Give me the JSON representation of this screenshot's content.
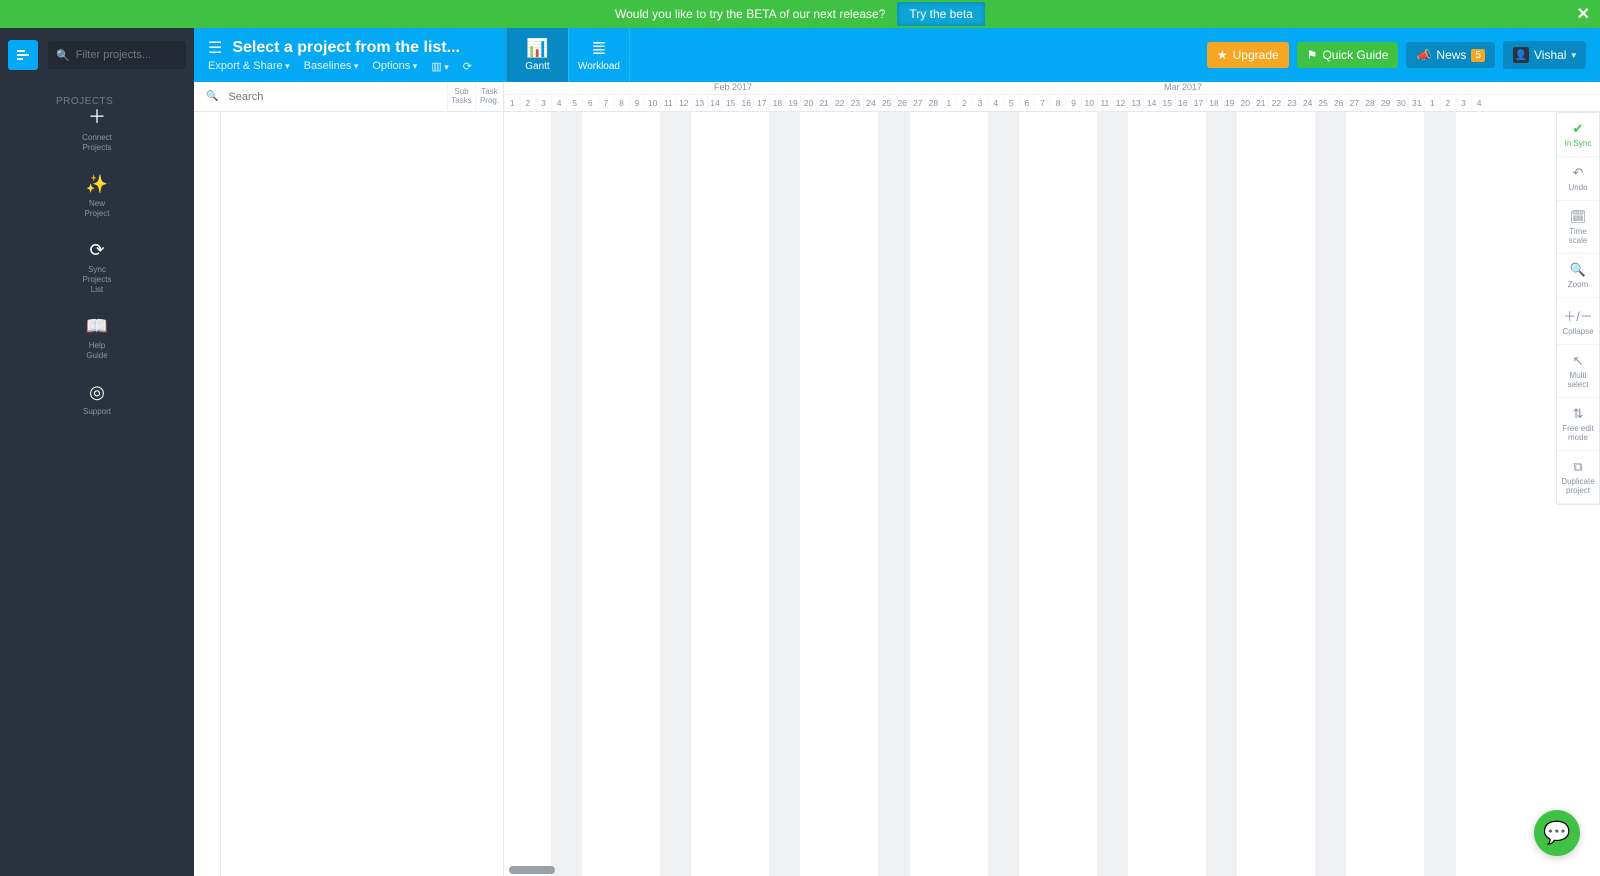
{
  "banner": {
    "text": "Would you like to try the BETA of our next release?",
    "button": "Try the beta"
  },
  "sidebar": {
    "filter_placeholder": "Filter projects...",
    "projects_label": "PROJECTS",
    "items": [
      {
        "label": "Connect\nProjects"
      },
      {
        "label": "New\nProject"
      },
      {
        "label": "Sync Projects\nList"
      },
      {
        "label": "Help\nGuide"
      },
      {
        "label": "Support"
      }
    ]
  },
  "topbar": {
    "title": "Select a project from the list...",
    "menu": {
      "export": "Export & Share",
      "baselines": "Baselines",
      "options": "Options"
    },
    "views": {
      "gantt": "Gantt",
      "workload": "Workload"
    },
    "upgrade": "Upgrade",
    "quick_guide": "Quick Guide",
    "news": "News",
    "news_badge": "5",
    "user": "Vishal"
  },
  "grid": {
    "search_placeholder": "Search",
    "col_sub_tasks_1": "Sub",
    "col_sub_tasks_2": "Tasks",
    "col_task_prog_1": "Task",
    "col_task_prog_2": "Prog."
  },
  "timeline": {
    "months": [
      "Feb 2017",
      "Mar 2017"
    ],
    "days": [
      1,
      2,
      3,
      4,
      5,
      6,
      7,
      8,
      9,
      10,
      11,
      12,
      13,
      14,
      15,
      16,
      17,
      18,
      19,
      20,
      21,
      22,
      23,
      24,
      25,
      26,
      27,
      28,
      1,
      2,
      3,
      4,
      5,
      6,
      7,
      8,
      9,
      10,
      11,
      12,
      13,
      14,
      15,
      16,
      17,
      18,
      19,
      20,
      21,
      22,
      23,
      24,
      25,
      26,
      27,
      28,
      29,
      30,
      31,
      1,
      2,
      3,
      4
    ],
    "weekend_start_indices": [
      3,
      10,
      17,
      24,
      31,
      38,
      45,
      52,
      59
    ],
    "month_positions": [
      210,
      660
    ]
  },
  "right_panel": {
    "items": [
      {
        "label": "In Sync"
      },
      {
        "label": "Undo"
      },
      {
        "label": "Time\nscale"
      },
      {
        "label": "Zoom"
      },
      {
        "label": "Collapse"
      },
      {
        "label": "Multi\nselect"
      },
      {
        "label": "Free edit\nmode"
      },
      {
        "label": "Duplicate\nproject"
      }
    ]
  }
}
